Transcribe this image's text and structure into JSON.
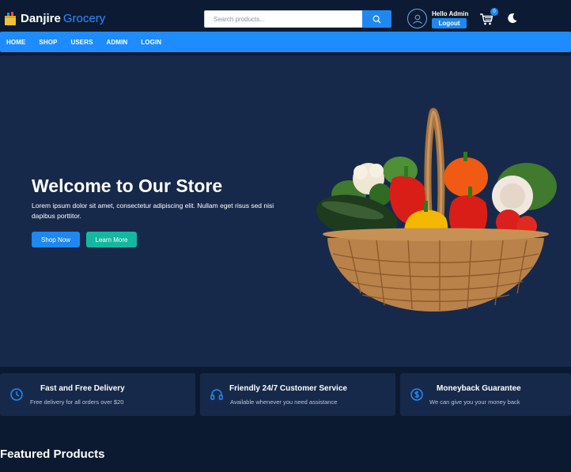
{
  "header": {
    "logo_name": "Danjire",
    "logo_sub": "Grocery",
    "search_placeholder": "Search products...",
    "greeting": "Hello Admin",
    "logout_label": "Logout",
    "cart_count": "0"
  },
  "nav": {
    "items": [
      "HOME",
      "SHOP",
      "USERS",
      "ADMIN",
      "LOGIN"
    ]
  },
  "hero": {
    "title": "Welcome to Our Store",
    "text": "Lorem ipsum dolor sit amet, consectetur adipiscing elit. Nullam eget risus sed nisi dapibus porttitor.",
    "shop_label": "Shop Now",
    "learn_label": "Learn More"
  },
  "features": [
    {
      "icon": "clock-icon",
      "title": "Fast and Free Delivery",
      "text": "Free delivery for all orders over $20"
    },
    {
      "icon": "headphones-icon",
      "title": "Friendly 24/7 Customer Service",
      "text": "Available whenever you need assistance"
    },
    {
      "icon": "dollar-icon",
      "title": "Moneyback Guarantee",
      "text": "We can give you your money back"
    }
  ],
  "featured": {
    "title": "Featured Products"
  },
  "colors": {
    "primary": "#1e8cff",
    "accent": "#14b8a0",
    "background": "#0b1a30",
    "panel": "#17294a"
  }
}
